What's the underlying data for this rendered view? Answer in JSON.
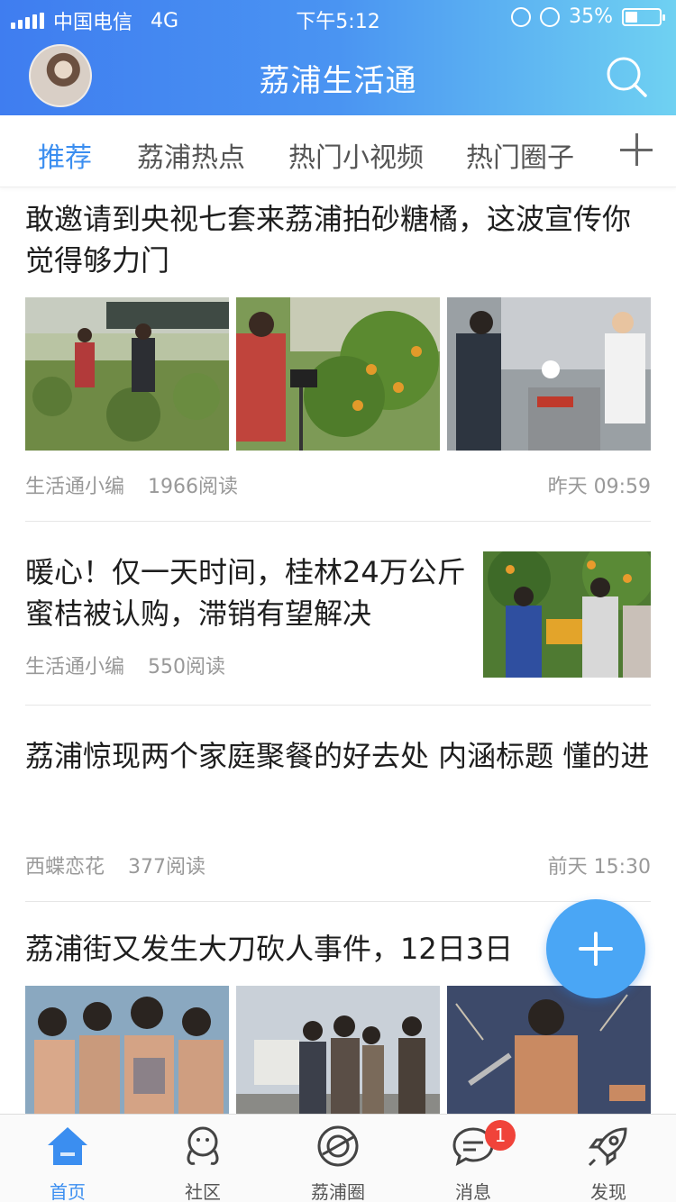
{
  "status_bar": {
    "carrier": "中国电信",
    "network": "4G",
    "time": "下午5:12",
    "battery": "35%",
    "battery_level": 0.35
  },
  "header": {
    "title": "荔浦生活通",
    "avatar_icon": "user-avatar",
    "search_icon": "search-icon"
  },
  "tabs": [
    {
      "label": "推荐",
      "active": true
    },
    {
      "label": "荔浦热点"
    },
    {
      "label": "热门小视频"
    },
    {
      "label": "热门圈子"
    }
  ],
  "articles": [
    {
      "title": "敢邀请到央视七套来荔浦拍砂糖橘，这波宣传你觉得够力门",
      "author": "生活通小编",
      "reads": "1966阅读",
      "time": "昨天 09:59"
    },
    {
      "title": "暖心！仅一天时间，桂林24万公斤蜜桔被认购，滞销有望解决",
      "author": "生活通小编",
      "reads": "550阅读"
    },
    {
      "title": "荔浦惊现两个家庭聚餐的好去处 内涵标题 懂的进",
      "author": "西蝶恋花",
      "reads": "377阅读",
      "time": "前天 15:30"
    },
    {
      "title": "荔浦街又发生大刀砍人事件，12日3日"
    }
  ],
  "bottom_nav": [
    {
      "label": "首页",
      "icon": "home-icon",
      "active": true
    },
    {
      "label": "社区",
      "icon": "community-icon"
    },
    {
      "label": "荔浦圈",
      "icon": "circle-icon"
    },
    {
      "label": "消息",
      "icon": "message-icon",
      "badge": "1"
    },
    {
      "label": "发现",
      "icon": "rocket-icon"
    }
  ],
  "colors": {
    "accent": "#3b8ef0",
    "header_start": "#3f7df0",
    "header_end": "#6fd1f2",
    "badge": "#f0433a",
    "fab": "#4aa6f5"
  }
}
